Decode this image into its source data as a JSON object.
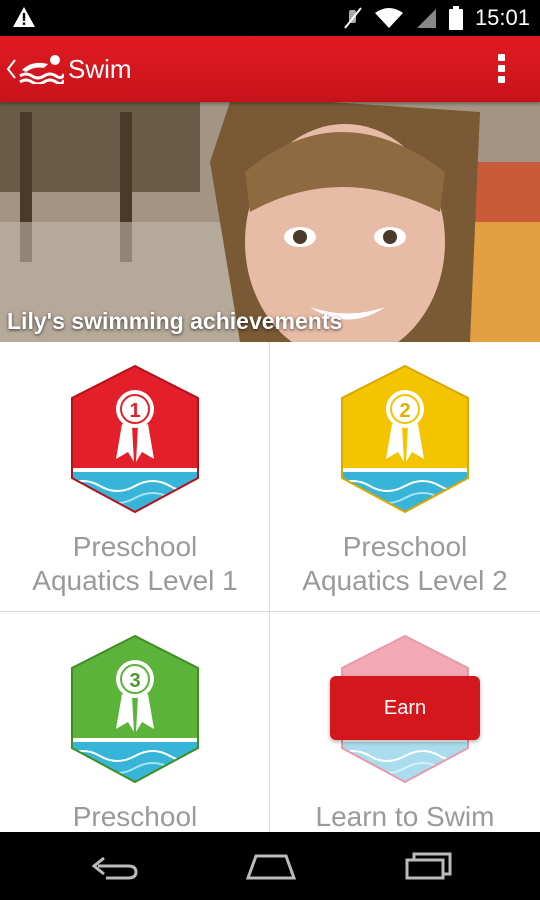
{
  "status": {
    "time": "15:01"
  },
  "appbar": {
    "title": "Swim"
  },
  "hero": {
    "caption": "Lily's swimming achievements"
  },
  "badges": [
    {
      "number": "1",
      "label_line1": "Preschool",
      "label_line2": "Aquatics Level 1",
      "color": "#e3202a"
    },
    {
      "number": "2",
      "label_line1": "Preschool",
      "label_line2": "Aquatics Level 2",
      "color": "#f5c400"
    },
    {
      "number": "3",
      "label_line1": "Preschool",
      "label_line2": "",
      "color": "#5cb33a"
    },
    {
      "label_line1": "Learn to Swim",
      "earn_label": "Earn",
      "color": "#f2a9b6"
    }
  ],
  "icons": {
    "warning": "warning-icon",
    "mute": "mute-icon",
    "wifi": "wifi-icon",
    "signal": "signal-icon",
    "battery": "battery-icon"
  }
}
